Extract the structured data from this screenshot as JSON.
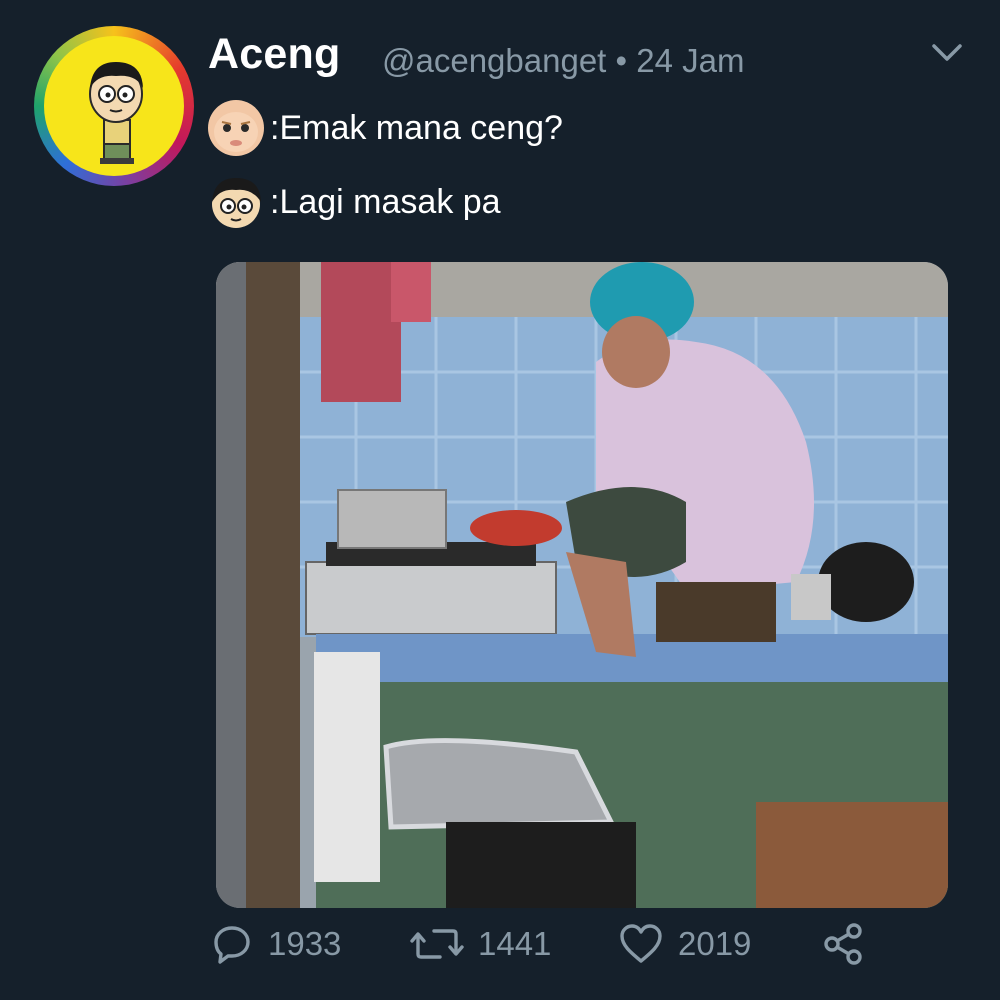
{
  "tweet": {
    "display_name": "Aceng",
    "handle_time": "@acengbanget • 24 Jam",
    "menu_icon": "chevron-down-icon",
    "lines": [
      {
        "speaker_icon": "baby-boss-emoji-icon",
        "text": ":Emak mana ceng?"
      },
      {
        "speaker_icon": "cartoon-boy-emoji-icon",
        "text": ":Lagi masak pa"
      }
    ],
    "photo_alt": "",
    "stats": {
      "replies": "1933",
      "retweets": "1441",
      "likes": "2019"
    }
  },
  "colors": {
    "background": "#15202b",
    "text": "#ffffff",
    "muted": "#8899a6"
  }
}
